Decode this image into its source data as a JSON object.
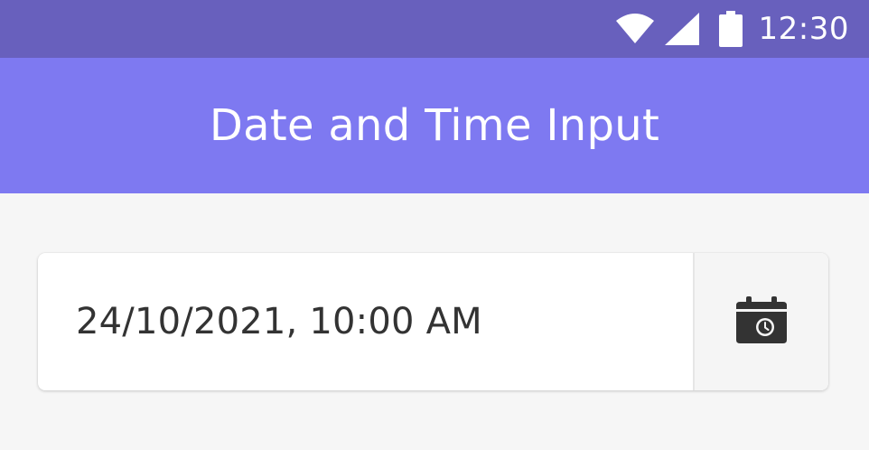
{
  "status_bar": {
    "time": "12:30",
    "icons": [
      "wifi-icon",
      "signal-icon",
      "battery-icon"
    ],
    "background": "#6860bd"
  },
  "app_bar": {
    "title": "Date and Time Input",
    "background": "#7e79f1"
  },
  "datetime_input": {
    "value": "24/10/2021, 10:00 AM",
    "picker_icon": "calendar-clock-icon"
  }
}
